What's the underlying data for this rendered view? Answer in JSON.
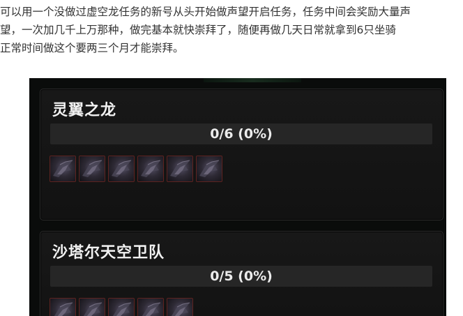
{
  "article": {
    "lines": [
      "可以用一个没做过虚空龙任务的新号从头开始做声望开启任务，任务中间会奖励大量声",
      "望，一次加几千上万那种，做完基本就快崇拜了，随便再做几天日常就拿到6只坐骑",
      "正常时间做这个要两三个月才能崇拜。"
    ]
  },
  "factions": [
    {
      "name": "灵翼之龙",
      "progress_text": "0/6 (0%)",
      "collected": 0,
      "total": 6,
      "icon": "nether-drake-icon"
    },
    {
      "name": "沙塔尔天空卫队",
      "progress_text": "0/5 (0%)",
      "collected": 0,
      "total": 5,
      "icon": "nether-ray-icon"
    }
  ],
  "colors": {
    "panel_bg": "#151515",
    "icon_border": "#5e2320",
    "text": "#f2f2f2"
  }
}
